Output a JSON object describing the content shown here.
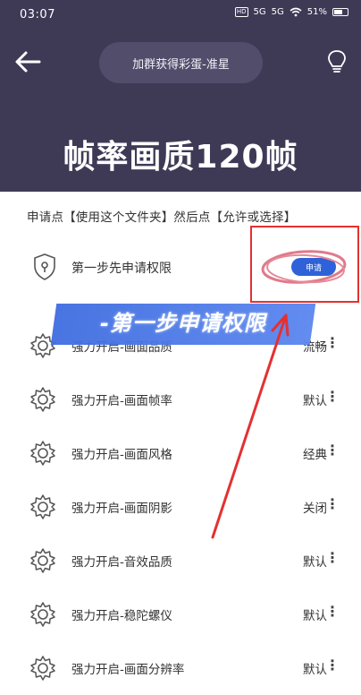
{
  "status_bar": {
    "time": "03:07",
    "hd_badge": "HD",
    "signal1": "5G",
    "signal2": "5G",
    "battery": "51%"
  },
  "header": {
    "back_icon": "back-arrow-icon",
    "title_pill": "加群获得彩蛋-准星",
    "bulb_icon": "lightbulb-icon"
  },
  "hero": {
    "title": "帧率画质120帧"
  },
  "instruction": "申请点【使用这个文件夹】然后点【允许或选择】",
  "permission": {
    "label": "第一步先申请权限",
    "button": "申请"
  },
  "overlay_banner": "-第一步申请权限",
  "settings": [
    {
      "title": "强力开启-画面品质",
      "value": "流畅"
    },
    {
      "title": "强力开启-画面帧率",
      "value": "默认"
    },
    {
      "title": "强力开启-画面风格",
      "value": "经典"
    },
    {
      "title": "强力开启-画面阴影",
      "value": "关闭"
    },
    {
      "title": "强力开启-音效品质",
      "value": "默认"
    },
    {
      "title": "强力开启-稳陀螺仪",
      "value": "默认"
    },
    {
      "title": "强力开启-画面分辨率",
      "value": "默认"
    }
  ],
  "more_glyph": "⋮",
  "colors": {
    "header_bg": "#3e3a56",
    "pill_bg": "#514d6b",
    "button_blue": "#2f62d8",
    "annotation_red": "#e53030",
    "banner_blue": "#3f6de0"
  }
}
